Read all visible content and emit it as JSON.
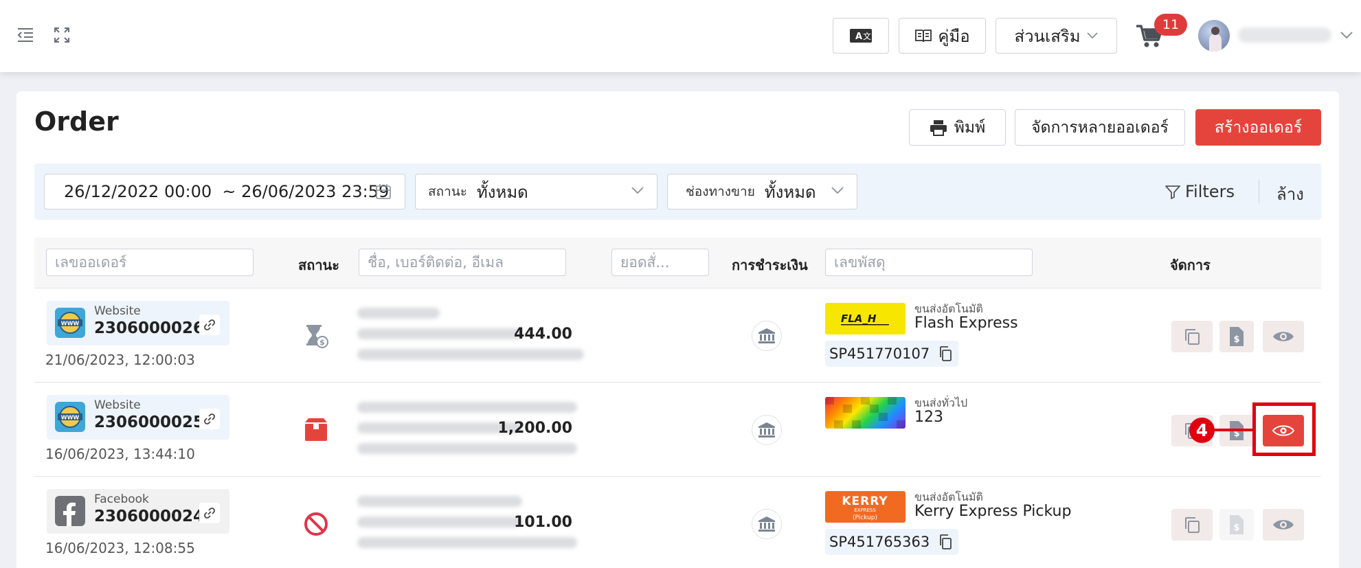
{
  "topbar": {
    "guide_label": "คู่มือ",
    "addons_label": "ส่วนเสริม",
    "cart_count": "11"
  },
  "page": {
    "title": "Order",
    "print_label": "พิมพ์",
    "bulk_label": "จัดการหลายออเดอร์",
    "create_label": "สร้างออเดอร์"
  },
  "filters": {
    "date_range": "26/12/2022 00:00  ~ 26/06/2023 23:59",
    "status_label": "สถานะ",
    "status_value": "ทั้งหมด",
    "channel_label": "ช่องทางขาย",
    "channel_value": "ทั้งหมด",
    "filters_label": "Filters",
    "clear_label": "ล้าง"
  },
  "table": {
    "order_no_placeholder": "เลขออเดอร์",
    "status_header": "สถานะ",
    "customer_placeholder": "ชื่อ, เบอร์ติดต่อ, อีเมล",
    "amount_placeholder": "ยอดสั่...",
    "payment_header": "การชำระเงิน",
    "tracking_placeholder": "เลขพัสดุ",
    "manage_header": "จัดการ"
  },
  "orders": [
    {
      "source": "Website",
      "order_no": "2306000026",
      "date": "21/06/2023, 12:00:03",
      "status_icon": "hourglass-payment-icon",
      "amount": "444.00",
      "payment_icon": "bank-icon",
      "shipping_type": "ขนส่งอัตโนมัติ",
      "carrier": "Flash Express",
      "tracking": "SP451770107"
    },
    {
      "source": "Website",
      "order_no": "2306000025",
      "date": "16/06/2023, 13:44:10",
      "status_icon": "box-icon",
      "amount": "1,200.00",
      "payment_icon": "bank-icon",
      "shipping_type": "ขนส่งทั่วไป",
      "carrier": "123",
      "tracking": ""
    },
    {
      "source": "Facebook",
      "order_no": "2306000024",
      "date": "16/06/2023, 12:08:55",
      "status_icon": "cancelled-icon",
      "amount": "101.00",
      "payment_icon": "bank-icon",
      "shipping_type": "ขนส่งอัตโนมัติ",
      "carrier": "Kerry Express Pickup",
      "tracking": "SP451765363"
    }
  ],
  "annotation": {
    "step": "4"
  },
  "colors": {
    "accent": "#e5443c",
    "filter_bg": "#eef4fb",
    "annotation": "#e0000f"
  }
}
